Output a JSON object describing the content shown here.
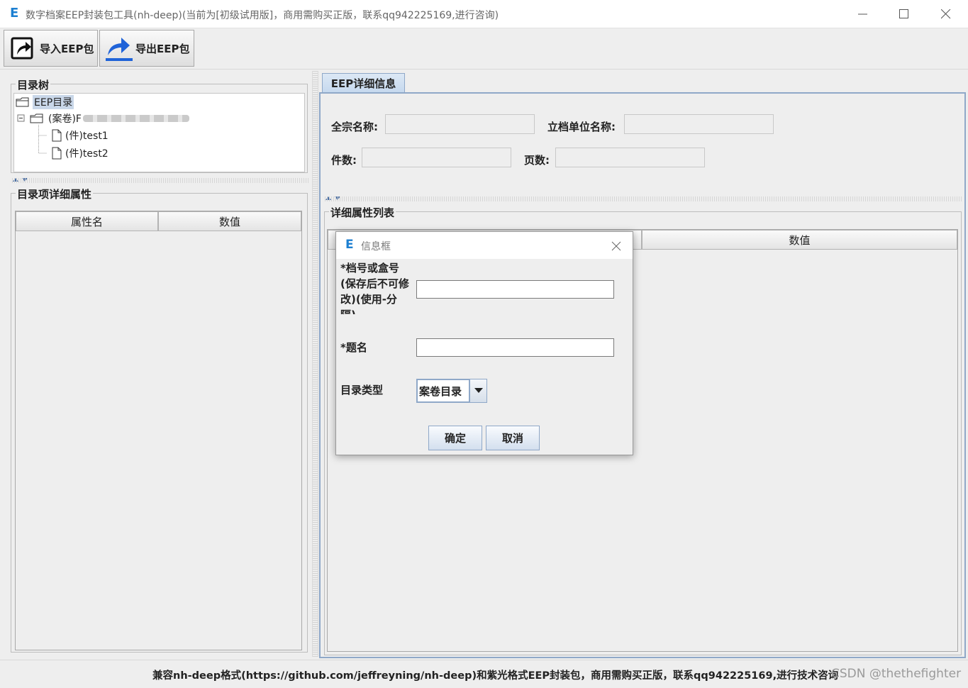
{
  "window": {
    "logo": "E",
    "title": "数字档案EEP封装包工具(nh-deep)(当前为[初级试用版]，商用需购买正版，联系qq942225169,进行咨询)"
  },
  "toolbar": {
    "import_label": "导入EEP包",
    "export_label": "导出EEP包"
  },
  "tree": {
    "group_title": "目录树",
    "root": "EEP目录",
    "folder": "(案卷)F",
    "items": [
      "(件)test1",
      "(件)test2"
    ]
  },
  "props": {
    "group_title": "目录项详细属性",
    "columns": [
      "属性名",
      "数值"
    ]
  },
  "detail": {
    "tab": "EEP详细信息",
    "fields": {
      "fonds_name": "全宗名称:",
      "unit_name": "立档单位名称:",
      "pieces": "件数:",
      "pages": "页数:"
    },
    "list_title": "详细属性列表",
    "list_value_col": "数值"
  },
  "dialog": {
    "logo": "E",
    "title": "信息框",
    "label_number": "*档号或盒号(保存后不可修改)(使用-分隔)",
    "label_title": "*题名",
    "label_type": "目录类型",
    "type_value": "案卷目录",
    "ok": "确定",
    "cancel": "取消"
  },
  "status": {
    "text": "兼容nh-deep格式(https://github.com/jeffreyning/nh-deep)和紫光格式EEP封装包，商用需购买正版，联系qq942225169,进行技术咨询",
    "watermark": "CSDN @thethefighter"
  }
}
